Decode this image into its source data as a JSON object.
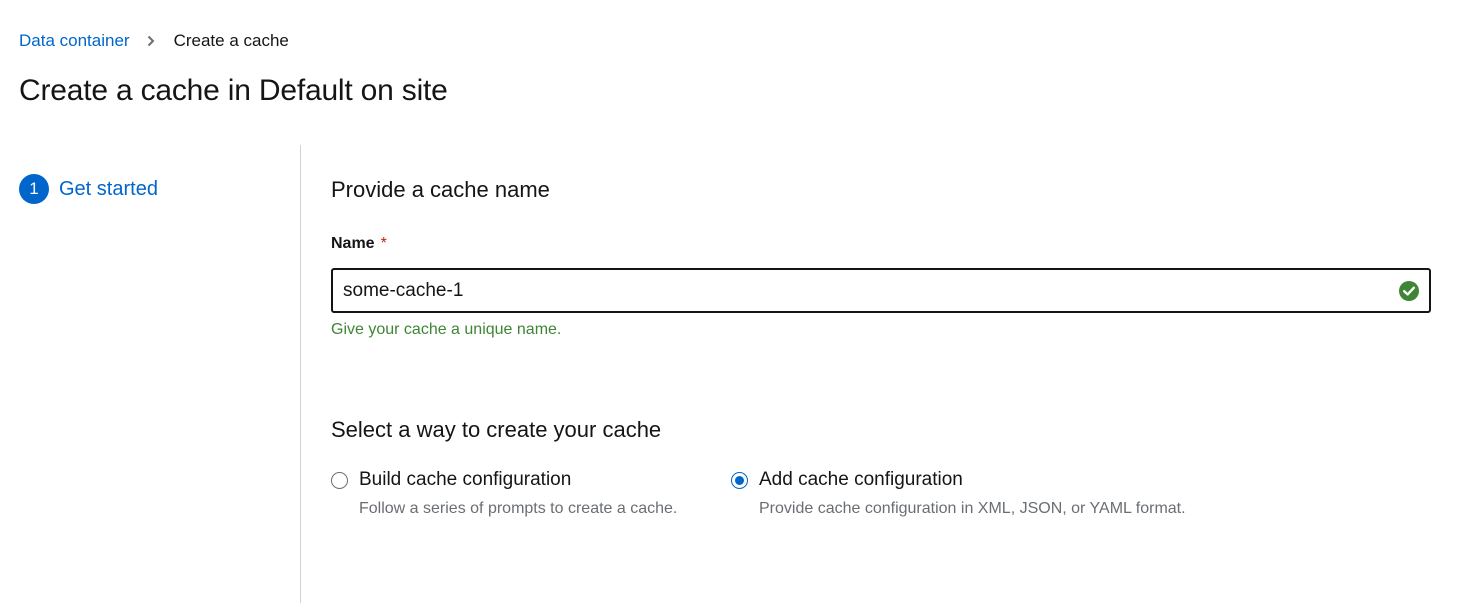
{
  "breadcrumb": {
    "parent": "Data container",
    "current": "Create a cache"
  },
  "page": {
    "title": "Create a cache in Default on site"
  },
  "wizard_nav": {
    "steps": [
      {
        "number": "1",
        "label": "Get started",
        "active": true
      }
    ]
  },
  "form": {
    "name_section_title": "Provide a cache name",
    "name_label": "Name",
    "required_marker": "*",
    "name_value": "some-cache-1",
    "name_helper": "Give your cache a unique name.",
    "name_valid_icon": "check-circle-icon",
    "method_section_title": "Select a way to create your cache",
    "options": [
      {
        "label": "Build cache configuration",
        "description": "Follow a series of prompts to create a cache.",
        "checked": false
      },
      {
        "label": "Add cache configuration",
        "description": "Provide cache configuration in XML, JSON, or YAML format.",
        "checked": true
      }
    ]
  },
  "colors": {
    "link": "#0066cc",
    "success": "#3e8635",
    "required": "#c9190b",
    "muted": "#6a6e73"
  }
}
